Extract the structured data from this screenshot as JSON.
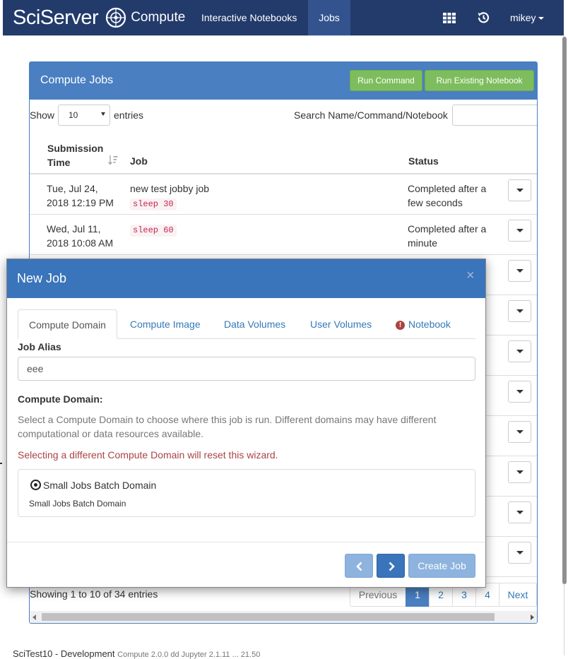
{
  "navbar": {
    "brand_sci": "SciServer",
    "brand_compute": "Compute",
    "links": [
      {
        "label": "Interactive Notebooks"
      },
      {
        "label": "Jobs"
      }
    ],
    "user": "mikey"
  },
  "panel": {
    "title": "Compute Jobs",
    "buttons": {
      "run_command": "Run Command",
      "run_notebook": "Run Existing Notebook"
    },
    "controls": {
      "show_label": "Show",
      "entries_value": "10",
      "entries_label": "entries",
      "search_label": "Search Name/Command/Notebook",
      "search_value": ""
    },
    "columns": {
      "time_line1": "Submission",
      "time_line2": "Time",
      "job": "Job",
      "status": "Status"
    },
    "rows": [
      {
        "time1": "Tue, Jul 24,",
        "time2": "2018 12:19 PM",
        "job_name": "new test jobby job",
        "command": "sleep 30",
        "status1": "Completed after a",
        "status2": "few seconds"
      },
      {
        "time1": "Wed, Jul 11,",
        "time2": "2018 10:08 AM",
        "job_name": "",
        "command": "sleep 60",
        "status1": "Completed after a",
        "status2": "minute"
      }
    ],
    "showing": "Showing 1 to 10 of 34 entries",
    "pagination": {
      "previous": "Previous",
      "pages": [
        "1",
        "2",
        "3",
        "4"
      ],
      "active": "1",
      "next": "Next"
    }
  },
  "footer": {
    "text": "SciTest10 - Development",
    "extra": "Compute 2.0.0 dd Jupyter 2.1.11 ... 21.50"
  },
  "modal": {
    "title": "New Job",
    "close": "×",
    "tabs": [
      {
        "label": "Compute Domain",
        "active": true
      },
      {
        "label": "Compute Image"
      },
      {
        "label": "Data Volumes"
      },
      {
        "label": "User Volumes"
      },
      {
        "label": "Notebook",
        "warning": true
      }
    ],
    "warn_glyph": "!",
    "alias_label": "Job Alias",
    "alias_value": "eee",
    "section_title": "Compute Domain:",
    "description": "Select a Compute Domain to choose where this job is run. Different domains may have different computational or data resources available.",
    "warning": "Selecting a different Compute Domain will reset this wizard.",
    "domain": {
      "name": "Small Jobs Batch Domain",
      "subtitle": "Small Jobs Batch Domain",
      "selected": true
    },
    "create_label": "Create Job"
  },
  "colors": {
    "navbar": "#233b6b",
    "panel_header": "#4a7fc1",
    "success_button": "#7ebd5d",
    "modal_header": "#3a74ba",
    "warning_text": "#a94442",
    "code_text": "#c7254e"
  },
  "icons": [
    "globe-icon",
    "apps-grid-icon",
    "history-icon",
    "caret-down-icon",
    "sort-icon",
    "dropdown-icon",
    "close-icon",
    "warning-icon",
    "chevron-left-icon",
    "chevron-right-icon"
  ]
}
